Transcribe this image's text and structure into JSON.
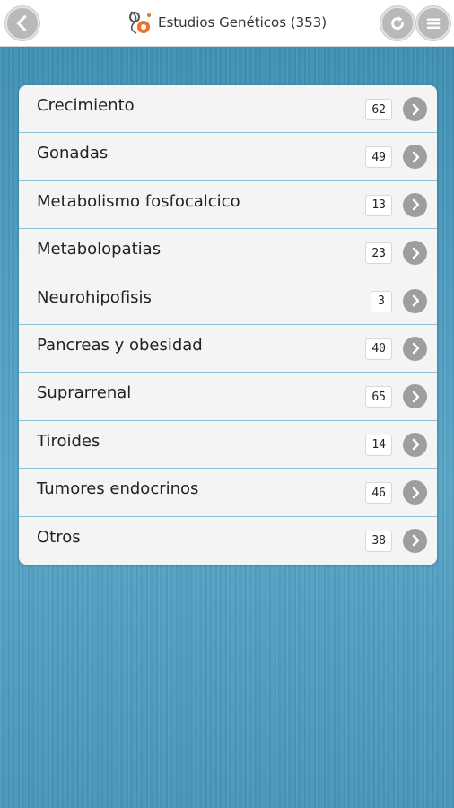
{
  "header": {
    "title": "Estudios Genéticos (353)",
    "back_icon": "chevron-left-icon",
    "refresh_icon": "refresh-icon",
    "menu_icon": "hamburger-menu-icon",
    "logo_icon": "dna-logo-icon"
  },
  "categories": [
    {
      "label": "Crecimiento",
      "count": "62"
    },
    {
      "label": "Gonadas",
      "count": "49"
    },
    {
      "label": "Metabolismo fosfocalcico",
      "count": "13"
    },
    {
      "label": "Metabolopatias",
      "count": "23"
    },
    {
      "label": "Neurohipofisis",
      "count": "3"
    },
    {
      "label": "Pancreas y obesidad",
      "count": "40"
    },
    {
      "label": "Suprarrenal",
      "count": "65"
    },
    {
      "label": "Tiroides",
      "count": "14"
    },
    {
      "label": "Tumores endocrinos",
      "count": "46"
    },
    {
      "label": "Otros",
      "count": "38"
    }
  ],
  "colors": {
    "background": "#4f9dc1",
    "row_divider": "#8cc3d9",
    "button_grey": "#9e9e9e"
  }
}
